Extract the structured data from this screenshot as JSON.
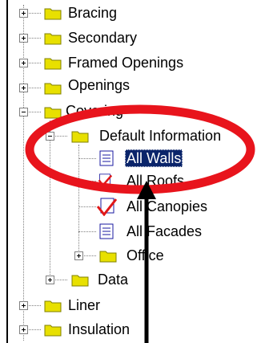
{
  "tree": {
    "items": [
      {
        "label": "Bracing",
        "expander": "+"
      },
      {
        "label": "Secondary",
        "expander": "+"
      },
      {
        "label": "Framed Openings",
        "expander": "+"
      },
      {
        "label": "Openings",
        "expander": "+"
      },
      {
        "label": "Covering",
        "expander": "-"
      },
      {
        "label": "Default Information",
        "expander": "-"
      },
      {
        "label": "All Walls",
        "selected": true
      },
      {
        "label": "All Roofs"
      },
      {
        "label": "All Canopies"
      },
      {
        "label": "All Facades"
      },
      {
        "label": "Office",
        "expander": "+"
      },
      {
        "label": "Data",
        "expander": "+"
      },
      {
        "label": "Liner",
        "expander": "+"
      },
      {
        "label": "Insulation",
        "expander": "+"
      }
    ]
  },
  "annotation": {
    "highlight_color": "#e8141c",
    "arrow_color": "#000000"
  },
  "colors": {
    "folder_fill": "#e8e000",
    "folder_edge": "#808000",
    "selection_bg": "#0a246a",
    "check_red": "#e01818"
  }
}
